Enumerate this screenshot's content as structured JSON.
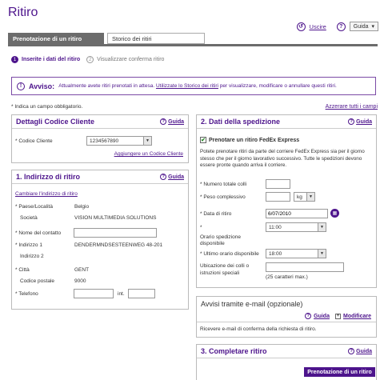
{
  "header": {
    "title": "Ritiro",
    "logout": "Uscire",
    "help": "Guida"
  },
  "tabs": [
    "Prenotazione di un ritiro",
    "Storico dei ritiri"
  ],
  "steps": {
    "step1_num": "1",
    "step1": "Inserite i dati del ritiro",
    "step2_num": "2",
    "step2": "Visualizzare conferma ritiro"
  },
  "notice": {
    "label": "Avviso:",
    "text1": "Attualmente avete ritiri prenotati in attesa.",
    "link": "Utilizzate lo Storico dei ritiri",
    "text2": "per visualizzare, modificare o annullare questi ritiri."
  },
  "required_note": "* Indica un campo obbligatorio.",
  "clear_all": "Azzerare tutti i campi",
  "customer": {
    "title": "Dettagli Codice Cliente",
    "help": "Guida",
    "code_label": "* Codice Cliente",
    "code_value": "1234567890",
    "add_link": "Aggiungere un Codice Cliente"
  },
  "address": {
    "title": "1. Indirizzo di ritiro",
    "help": "Guida",
    "change_link": "Cambiare l'indirizzo di ritiro",
    "country_label": "* Paese/Località",
    "country_value": "Belgio",
    "company_label": "Società",
    "company_value": "VISION MULTIMEDIA SOLUTIONS",
    "contact_label": "* Nome del contatto",
    "addr1_label": "* Indirizzo 1",
    "addr1_value": "DENDERMNDSESTEENWEG 48-201",
    "addr2_label": "Indirizzo 2",
    "city_label": "* Città",
    "city_value": "GENT",
    "postal_label": "Codice postale",
    "postal_value": "9000",
    "phone_label": "* Telefono",
    "ext_label": "int."
  },
  "shipment": {
    "title": "2. Dati della spedizione",
    "help": "Guida",
    "express_label": "Prenotare un ritiro FedEx Express",
    "express_text": "Potete prenotare ritiri da parte del corriere FedEx Express sia per il giorno stesso che per il giorno lavorativo successivo. Tutte le spedizioni devono essere pronte quando arriva il corriere.",
    "packages_label": "* Numero totale colli",
    "weight_label": "* Peso complessivo",
    "weight_unit": "kg",
    "date_label": "* Data di ritiro",
    "date_value": "6/07/2010",
    "ready_label": "*",
    "ready_value": "11:00",
    "ready_sublabel": "Orario spedizione disponibile",
    "last_label": "* Ultimo orario disponibile",
    "last_value": "18:00",
    "location_label": "Ubicazione dei colli o istruzioni speciali",
    "location_hint": "(25 caratteri max.)"
  },
  "email": {
    "title": "Avvisi tramite e-mail (opzionale)",
    "help": "Guida",
    "modify": "Modificare",
    "text": "Ricevere e-mail di conferma della richiesta di ritiro."
  },
  "complete": {
    "title": "3. Completare ritiro",
    "help": "Guida",
    "button": "Prenotazione di un ritiro"
  }
}
